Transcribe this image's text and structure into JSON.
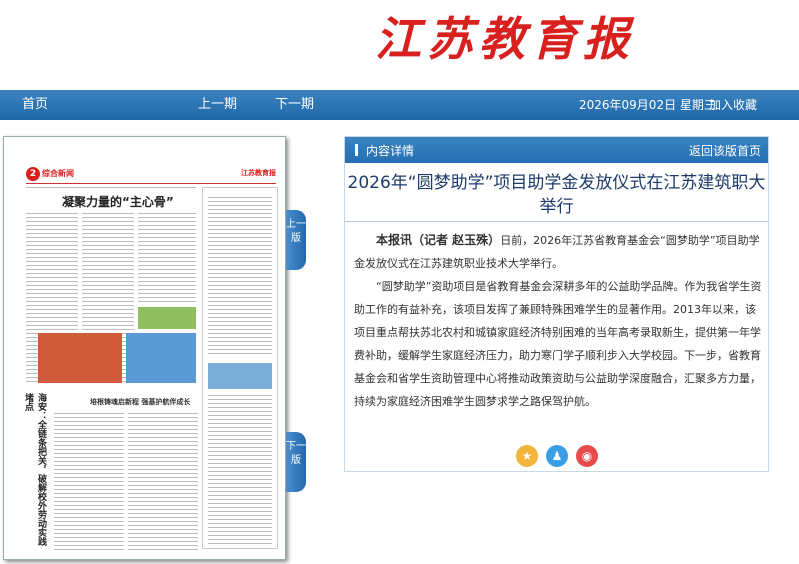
{
  "masthead": "江苏教育报",
  "nav": {
    "home": "首页",
    "prev_issue": "上一期",
    "next_issue": "下一期",
    "date": "2026年09月02日 星期三",
    "favorite": "加入收藏"
  },
  "thumbnail": {
    "page_num": "2",
    "section": "综合新闻",
    "brand": "江苏教育报",
    "headline": "凝聚力量的“主心骨”",
    "subhead": "培根铸魂启新程  强基护航伴成长",
    "vertical_title": "海安：全链条把关，破解校外劳动实践堵点"
  },
  "side_buttons": {
    "prev_page": "上一版",
    "next_page": "下一版"
  },
  "panel": {
    "label": "内容详情",
    "return": "返回该版首页",
    "title": "2026年“圆梦助学”项目助学金发放仪式在江苏建筑职大举行",
    "byline": "本报讯（记者  赵玉殊）",
    "p1": "日前，2026年江苏省教育基金会“圆梦助学”项目助学金发放仪式在江苏建筑职业技术大学举行。",
    "p2": "“圆梦助学”资助项目是省教育基金会深耕多年的公益助学品牌。作为我省学生资助工作的有益补充，该项目发挥了兼顾特殊困难学生的显著作用。2013年以来，该项目重点帮扶苏北农村和城镇家庭经济特别困难的当年高考录取新生，提供第一年学费补助，缓解学生家庭经济压力，助力寒门学子顺利步入大学校园。下一步，省教育基金会和省学生资助管理中心将推动政策资助与公益助学深度融合，汇聚多方力量，持续为家庭经济困难学生圆梦求学之路保驾护航。"
  },
  "share_icons": [
    "star-icon",
    "qq-icon",
    "weibo-icon"
  ]
}
